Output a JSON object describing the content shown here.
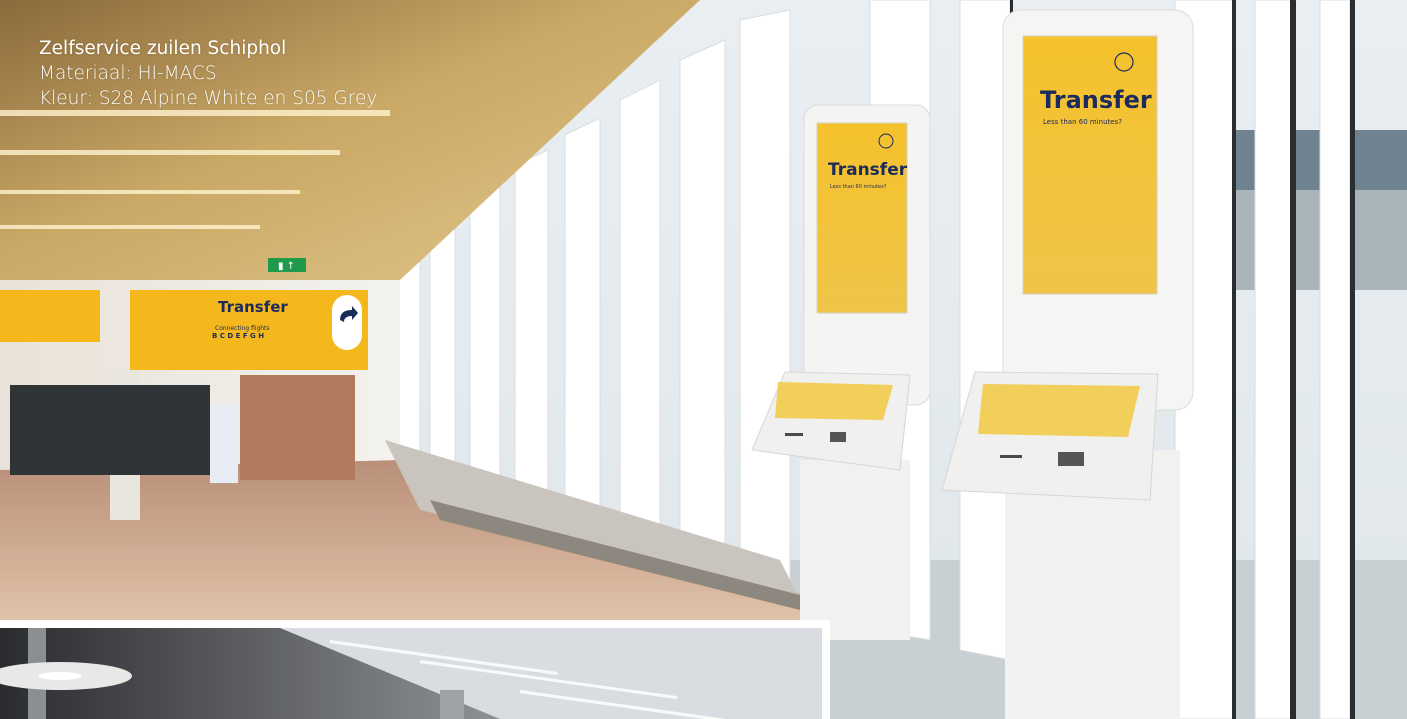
{
  "caption": {
    "title": "Zelfservice zuilen Schiphol",
    "material": "Materiaal: HI-MACS",
    "color": "Kleur: S28 Alpine White en S05 Grey"
  },
  "kiosks": [
    {
      "heading": "Transfer",
      "subtitle": "Less than 60 minutes?"
    },
    {
      "heading": "Transfer",
      "subtitle": "Less than 60 minutes?"
    }
  ],
  "hall_sign": {
    "heading": "Transfer",
    "line1": "Connecting flights",
    "gates": "B C D E F G H"
  },
  "colors": {
    "kiosk_screen": "#f2c230",
    "sign_yellow": "#f4b81c",
    "ceiling_gold": "#c9a464",
    "kiosk_white": "#f4f4f2",
    "floor": "#c9a48a"
  },
  "icons": [
    "plane-icon",
    "arrow-turn-icon",
    "exit-icon"
  ]
}
